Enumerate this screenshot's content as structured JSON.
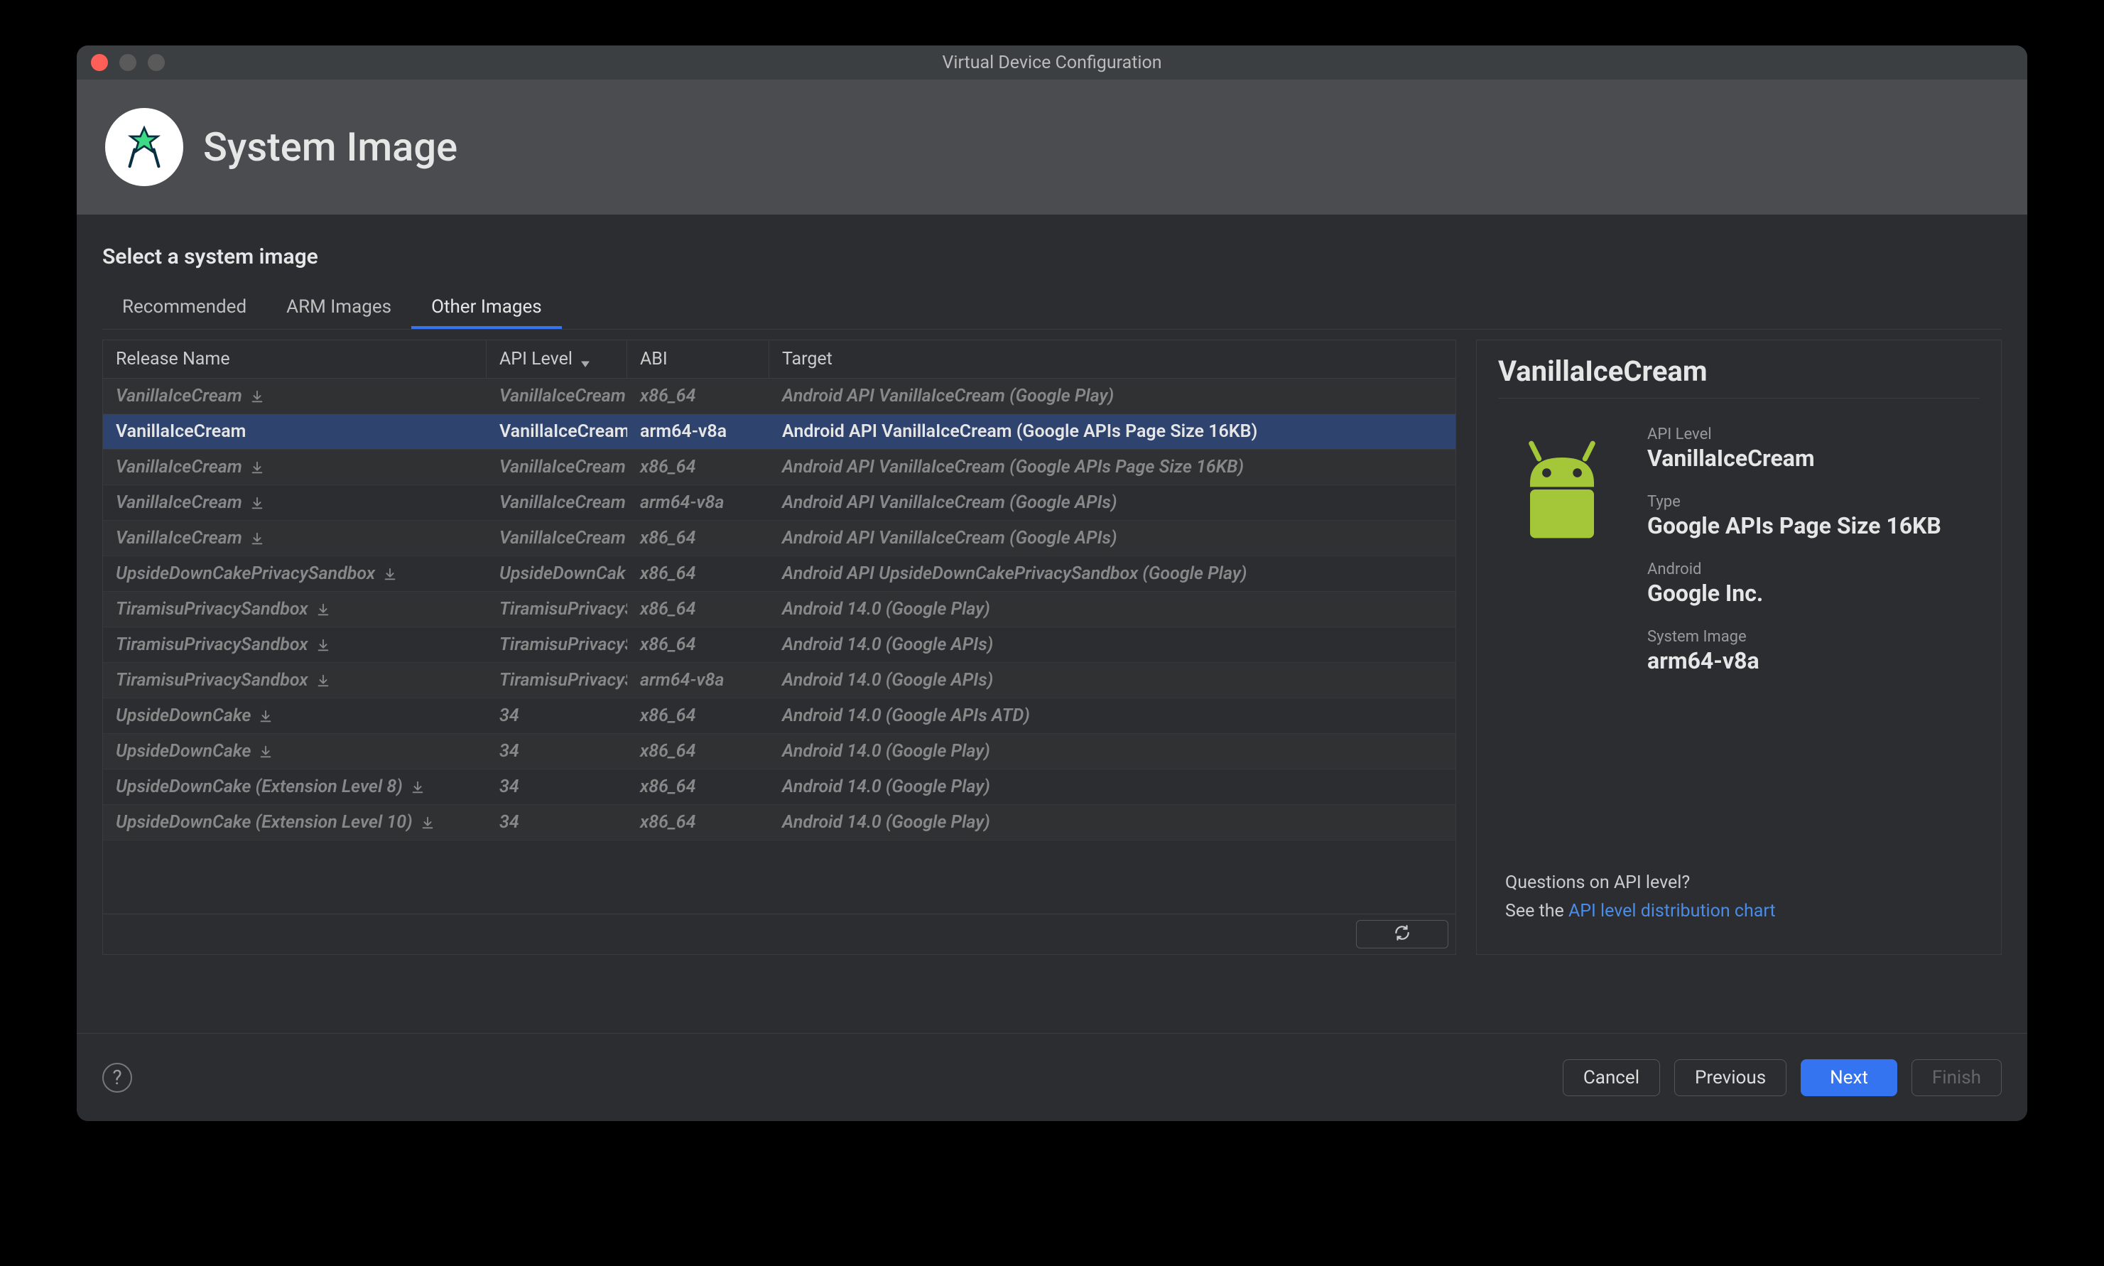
{
  "window": {
    "title": "Virtual Device Configuration"
  },
  "header": {
    "title": "System Image"
  },
  "subtitle": "Select a system image",
  "tabs": [
    {
      "label": "Recommended",
      "active": false
    },
    {
      "label": "ARM Images",
      "active": false
    },
    {
      "label": "Other Images",
      "active": true
    }
  ],
  "table": {
    "headers": {
      "release": "Release Name",
      "api": "API Level",
      "abi": "ABI",
      "target": "Target"
    },
    "rows": [
      {
        "release": "VanillaIceCream",
        "dl": true,
        "api": "VanillaIceCream",
        "abi": "x86_64",
        "target": "Android API VanillaIceCream (Google Play)",
        "selected": false
      },
      {
        "release": "VanillaIceCream",
        "dl": false,
        "api": "VanillaIceCream",
        "abi": "arm64-v8a",
        "target": "Android API VanillaIceCream (Google APIs Page Size 16KB)",
        "selected": true
      },
      {
        "release": "VanillaIceCream",
        "dl": true,
        "api": "VanillaIceCream",
        "abi": "x86_64",
        "target": "Android API VanillaIceCream (Google APIs Page Size 16KB)",
        "selected": false
      },
      {
        "release": "VanillaIceCream",
        "dl": true,
        "api": "VanillaIceCream",
        "abi": "arm64-v8a",
        "target": "Android API VanillaIceCream (Google APIs)",
        "selected": false
      },
      {
        "release": "VanillaIceCream",
        "dl": true,
        "api": "VanillaIceCream",
        "abi": "x86_64",
        "target": "Android API VanillaIceCream (Google APIs)",
        "selected": false
      },
      {
        "release": "UpsideDownCakePrivacySandbox",
        "dl": true,
        "api": "UpsideDownCak",
        "abi": "x86_64",
        "target": "Android API UpsideDownCakePrivacySandbox (Google Play)",
        "selected": false
      },
      {
        "release": "TiramisuPrivacySandbox",
        "dl": true,
        "api": "TiramisuPrivacyS",
        "abi": "x86_64",
        "target": "Android 14.0 (Google Play)",
        "selected": false
      },
      {
        "release": "TiramisuPrivacySandbox",
        "dl": true,
        "api": "TiramisuPrivacyS",
        "abi": "x86_64",
        "target": "Android 14.0 (Google APIs)",
        "selected": false
      },
      {
        "release": "TiramisuPrivacySandbox",
        "dl": true,
        "api": "TiramisuPrivacyS",
        "abi": "arm64-v8a",
        "target": "Android 14.0 (Google APIs)",
        "selected": false
      },
      {
        "release": "UpsideDownCake",
        "dl": true,
        "api": "34",
        "abi": "x86_64",
        "target": "Android 14.0 (Google APIs ATD)",
        "selected": false
      },
      {
        "release": "UpsideDownCake",
        "dl": true,
        "api": "34",
        "abi": "x86_64",
        "target": "Android 14.0 (Google Play)",
        "selected": false
      },
      {
        "release": "UpsideDownCake (Extension Level 8)",
        "dl": true,
        "api": "34",
        "abi": "x86_64",
        "target": "Android 14.0 (Google Play)",
        "selected": false
      },
      {
        "release": "UpsideDownCake (Extension Level 10)",
        "dl": true,
        "api": "34",
        "abi": "x86_64",
        "target": "Android 14.0 (Google Play)",
        "selected": false
      }
    ]
  },
  "details": {
    "title": "VanillaIceCream",
    "fields": {
      "api_label": "API Level",
      "api_value": "VanillaIceCream",
      "type_label": "Type",
      "type_value": "Google APIs Page Size 16KB",
      "android_label": "Android",
      "android_value": "Google Inc.",
      "sys_label": "System Image",
      "sys_value": "arm64-v8a"
    },
    "footer": {
      "question": "Questions on API level?",
      "see": "See the ",
      "link": "API level distribution chart"
    }
  },
  "buttons": {
    "help": "?",
    "cancel": "Cancel",
    "previous": "Previous",
    "next": "Next",
    "finish": "Finish"
  }
}
